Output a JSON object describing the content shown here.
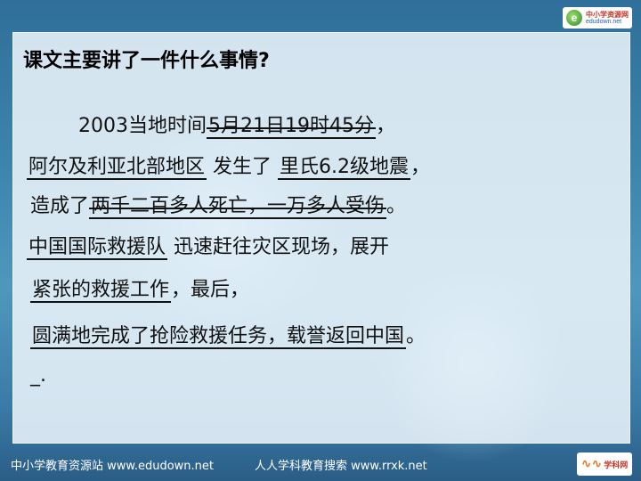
{
  "slide": {
    "title": "课文主要讲了一件什么事情?",
    "lines": [
      {
        "a": "2003当地时间",
        "b": "5月21日19时45分",
        "c": "，"
      },
      {
        "a": "阿尔及利亚北部地区",
        "b": "发生了",
        "c": "里氏6.2级地震",
        "d": "，"
      },
      {
        "a": "造成了",
        "b": "两千二百多人死亡，一万多人受伤",
        "c": "。"
      },
      {
        "a": "中国国际救援队",
        "b": "迅速赶往灾区现场，展开"
      },
      {
        "a": "紧张的救援工作",
        "b": "，最后，"
      },
      {
        "a": "圆满地完成了抢险救援任务，载誉返回中国",
        "b": "。"
      },
      {
        "a": "_."
      }
    ]
  },
  "header": {
    "logo_main": "中小学资源网",
    "logo_sub": "edudown.net"
  },
  "footer": {
    "left_text": "中小学教育资源站 www.edudown.net",
    "right_text": "人人学科教育搜索 www.rrxk.net",
    "logo_text": "学科网"
  }
}
